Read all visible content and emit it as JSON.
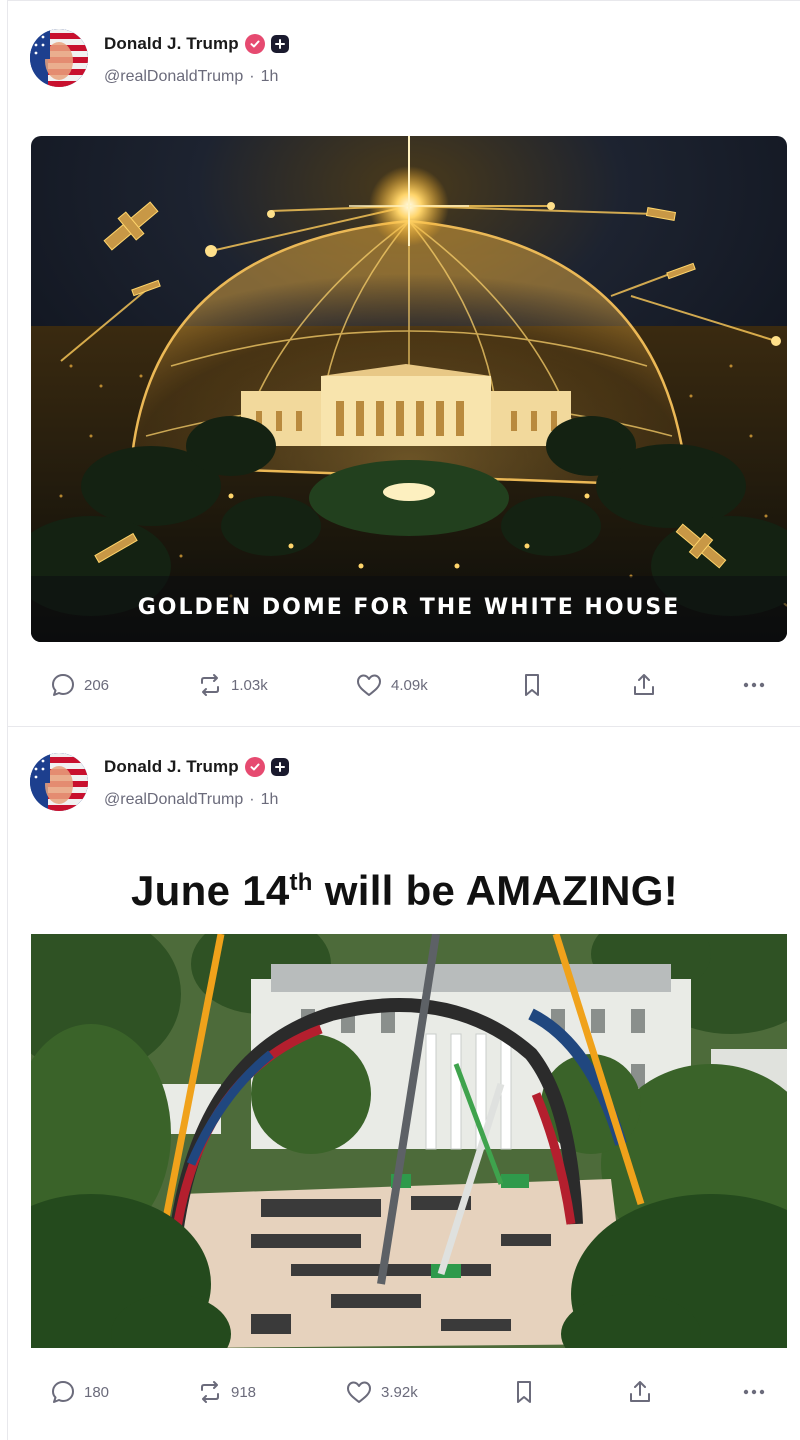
{
  "posts": [
    {
      "author": {
        "name": "Donald J. Trump",
        "handle": "@realDonaldTrump",
        "time": "1h",
        "verified_color": "#e64a70"
      },
      "media": {
        "caption": "GOLDEN DOME FOR THE WHITE HOUSE"
      },
      "actions": {
        "replies": "206",
        "reposts": "1.03k",
        "likes": "4.09k"
      }
    },
    {
      "author": {
        "name": "Donald J. Trump",
        "handle": "@realDonaldTrump",
        "time": "1h",
        "verified_color": "#e64a70"
      },
      "text": {
        "main": "June 14",
        "suffix": "th",
        "rest": " will be AMAZING!"
      },
      "actions": {
        "replies": "180",
        "reposts": "918",
        "likes": "3.92k"
      }
    }
  ],
  "icons": {
    "reply": "speech-bubble-icon",
    "repost": "repost-arrows-icon",
    "like": "heart-icon",
    "bookmark": "bookmark-icon",
    "share": "share-upload-icon",
    "more": "more-dots-icon"
  },
  "colors": {
    "accent_verified": "#e64a70",
    "muted_text": "#6b6b7b",
    "gold": "#f2b743"
  }
}
